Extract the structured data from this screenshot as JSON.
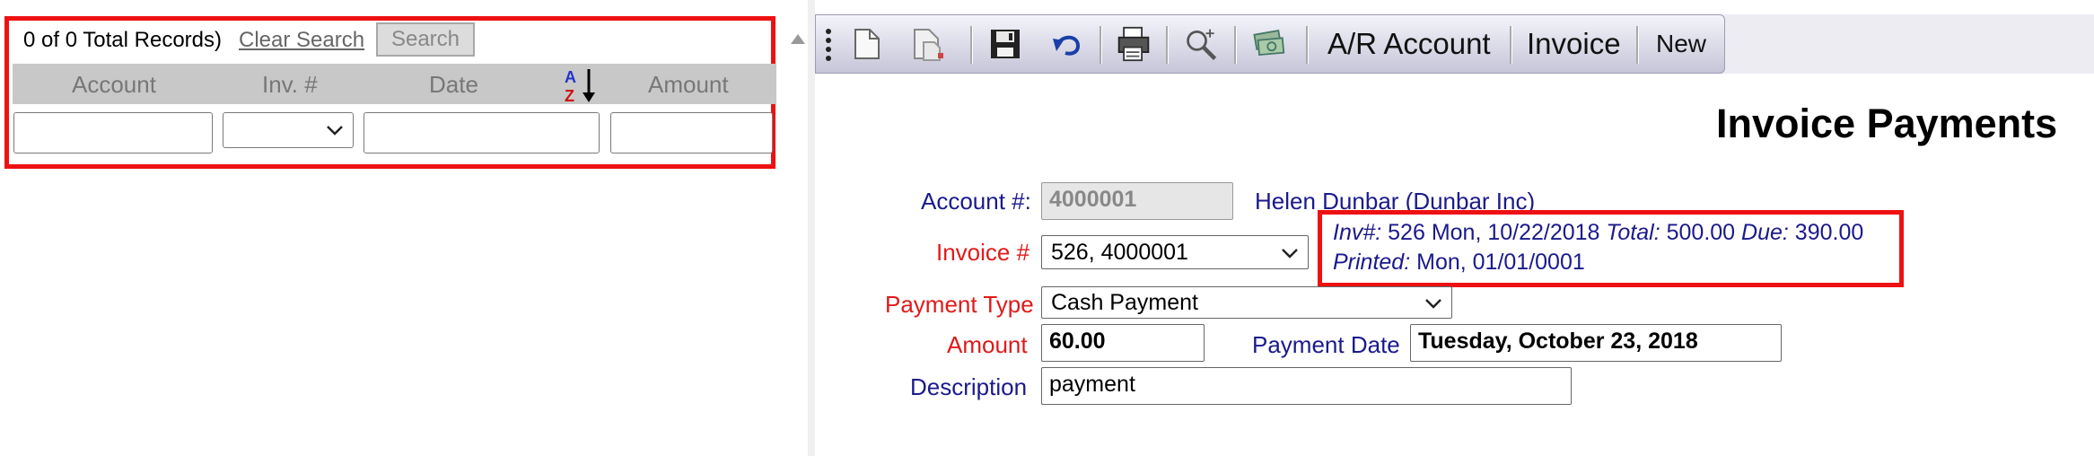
{
  "search_panel": {
    "records_text": "0 of 0 Total Records)",
    "clear_search": "Clear Search",
    "search_button": "Search",
    "columns": [
      "Account",
      "Inv. #",
      "Date",
      "Amount"
    ],
    "filters": {
      "account": "",
      "invoice": "",
      "date": "",
      "amount": ""
    }
  },
  "toolbar": {
    "buttons": [
      "new-document",
      "copy-document",
      "save",
      "undo",
      "print",
      "zoom-search",
      "money"
    ],
    "ar_account": "A/R Account",
    "invoice": "Invoice",
    "new": "New"
  },
  "form": {
    "title": "Invoice Payments",
    "account_label": "Account #:",
    "account_value": "4000001",
    "account_name": "Helen Dunbar (Dunbar Inc)",
    "invoice_label": "Invoice #",
    "invoice_value": "526, 4000001",
    "invoice_info": {
      "inv_label": "Inv#:",
      "inv_value": "526 Mon, 10/22/2018",
      "total_label": "Total:",
      "total_value": "500.00",
      "due_label": "Due:",
      "due_value": "390.00",
      "printed_label": "Printed:",
      "printed_value": "Mon, 01/01/0001"
    },
    "payment_type_label": "Payment Type",
    "payment_type_value": "Cash Payment",
    "amount_label": "Amount",
    "amount_value": "60.00",
    "payment_date_label": "Payment Date",
    "payment_date_value": "Tuesday, October 23, 2018",
    "description_label": "Description",
    "description_value": "payment"
  },
  "colors": {
    "highlight": "#ee1111",
    "label_blue": "#1a1a8c",
    "label_red": "#e01a1a"
  }
}
